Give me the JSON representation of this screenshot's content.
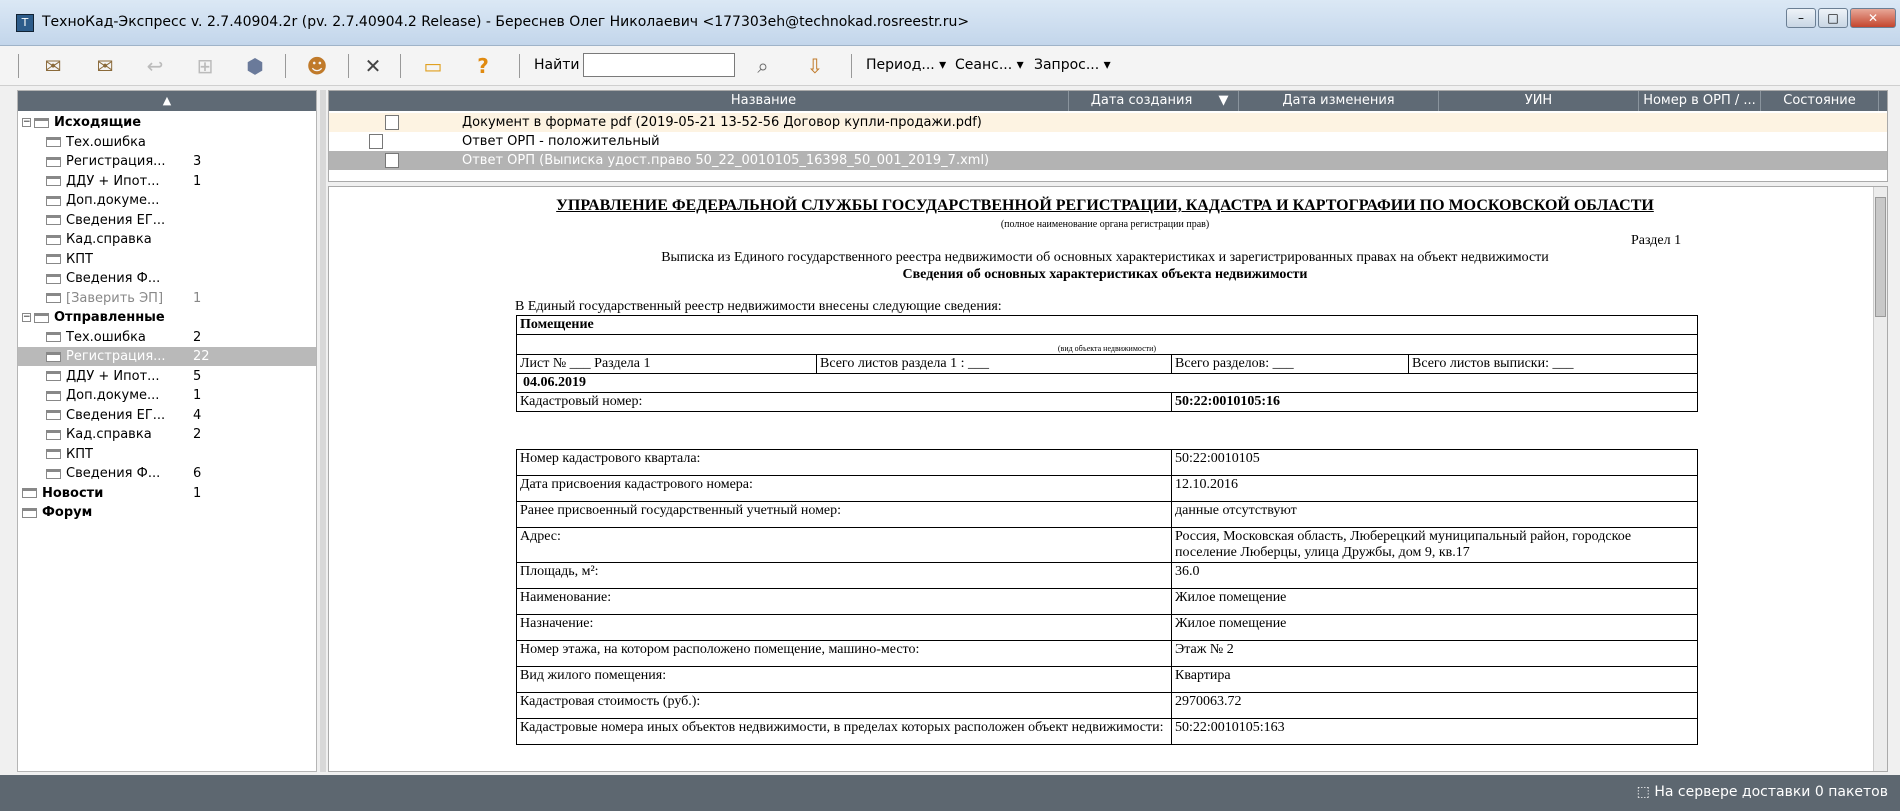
{
  "window": {
    "title": "ТехноКад-Экспресс v. 2.7.40904.2r (pv. 2.7.40904.2 Release) - Береснев Олег Николаевич <177303eh@technokad.rosreestr.ru>",
    "minimize": "–",
    "maximize": "□",
    "close": "✕"
  },
  "toolbar": {
    "search_label": "Найти",
    "search_value": "",
    "period": "Период... ▾",
    "session": "Сеанс... ▾",
    "request": "Запрос... ▾",
    "help": "?"
  },
  "tree": {
    "header": "▲",
    "items": [
      {
        "label": "Исходящие",
        "count": "",
        "bold": true
      },
      {
        "label": "Тех.ошибка",
        "count": ""
      },
      {
        "label": "Регистрация...",
        "count": "3"
      },
      {
        "label": "ДДУ + Ипот...",
        "count": "1"
      },
      {
        "label": "Доп.докуме...",
        "count": ""
      },
      {
        "label": "Сведения ЕГ...",
        "count": ""
      },
      {
        "label": "Кад.справка",
        "count": ""
      },
      {
        "label": "КПТ",
        "count": ""
      },
      {
        "label": "Сведения Ф...",
        "count": ""
      },
      {
        "label": "[Заверить ЭП]",
        "count": "1"
      },
      {
        "label": "Отправленные",
        "count": "",
        "bold": true
      },
      {
        "label": "Тех.ошибка",
        "count": "2"
      },
      {
        "label": "Регистрация...",
        "count": "22"
      },
      {
        "label": "ДДУ + Ипот...",
        "count": "5"
      },
      {
        "label": "Доп.докуме...",
        "count": "1"
      },
      {
        "label": "Сведения ЕГ...",
        "count": "4"
      },
      {
        "label": "Кад.справка",
        "count": "2"
      },
      {
        "label": "КПТ",
        "count": ""
      },
      {
        "label": "Сведения Ф...",
        "count": "6"
      },
      {
        "label": "Новости",
        "count": "1",
        "bold": true
      },
      {
        "label": "Форум",
        "count": "",
        "bold": true
      }
    ]
  },
  "grid": {
    "columns": [
      "Название",
      "Дата создания",
      "▼",
      "Дата изменения",
      "УИН",
      "Номер в ОРП / ...",
      "Состояние"
    ],
    "rows": [
      "Документ в формате pdf (2019-05-21 13-52-56 Договор купли-продажи.pdf)",
      "Ответ ОРП - положительный",
      "Ответ ОРП (Выписка удост.право 50_22_0010105_16398_50_001_2019_7.xml)"
    ]
  },
  "doc": {
    "title": "УПРАВЛЕНИЕ ФЕДЕРАЛЬНОЙ СЛУЖБЫ ГОСУДАРСТВЕННОЙ РЕГИСТРАЦИИ, КАДАСТРА И КАРТОГРАФИИ ПО МОСКОВСКОЙ ОБЛАСТИ",
    "subtitle": "(полное наименование органа регистрации прав)",
    "section": "Раздел 1",
    "line1": "Выписка из Единого государственного реестра недвижимости об основных характеристиках и зарегистрированных правах на объект недвижимости",
    "line2": "Сведения об основных характеристиках объекта недвижимости",
    "intro": "В Единый государственный реестр недвижимости внесены следующие сведения:",
    "object_type": "Помещение",
    "object_caption": "(вид объекта недвижимости)",
    "sheet": "Лист № ___ Раздела 1",
    "total_sheets_section": "Всего листов раздела 1 : ___",
    "total_sections": "Всего разделов: ___",
    "total_sheets": "Всего листов выписки: ___",
    "date": "04.06.2019",
    "cad_label": "Кадастровый номер:",
    "cad_value": "50:22:0010105:16",
    "rows": [
      {
        "k": "Номер кадастрового квартала:",
        "v": "50:22:0010105"
      },
      {
        "k": "Дата присвоения кадастрового номера:",
        "v": "12.10.2016"
      },
      {
        "k": "Ранее присвоенный государственный учетный номер:",
        "v": "данные отсутствуют"
      },
      {
        "k": "Адрес:",
        "v": "Россия, Московская область, Люберецкий муниципальный район, городское поселение Люберцы, улица Дружбы, дом 9, кв.17"
      },
      {
        "k": "Площадь, м²:",
        "v": "36.0"
      },
      {
        "k": "Наименование:",
        "v": "Жилое помещение"
      },
      {
        "k": "Назначение:",
        "v": "Жилое помещение"
      },
      {
        "k": "Номер этажа, на котором расположено помещение, машино-место:",
        "v": "Этаж № 2"
      },
      {
        "k": "Вид жилого помещения:",
        "v": "Квартира"
      },
      {
        "k": "Кадастровая стоимость (руб.):",
        "v": "2970063.72"
      },
      {
        "k": "Кадастровые номера иных объектов недвижимости, в пределах которых расположен объект недвижимости:",
        "v": "50:22:0010105:163"
      }
    ]
  },
  "status": {
    "text": "На сервере доставки 0 пакетов"
  }
}
